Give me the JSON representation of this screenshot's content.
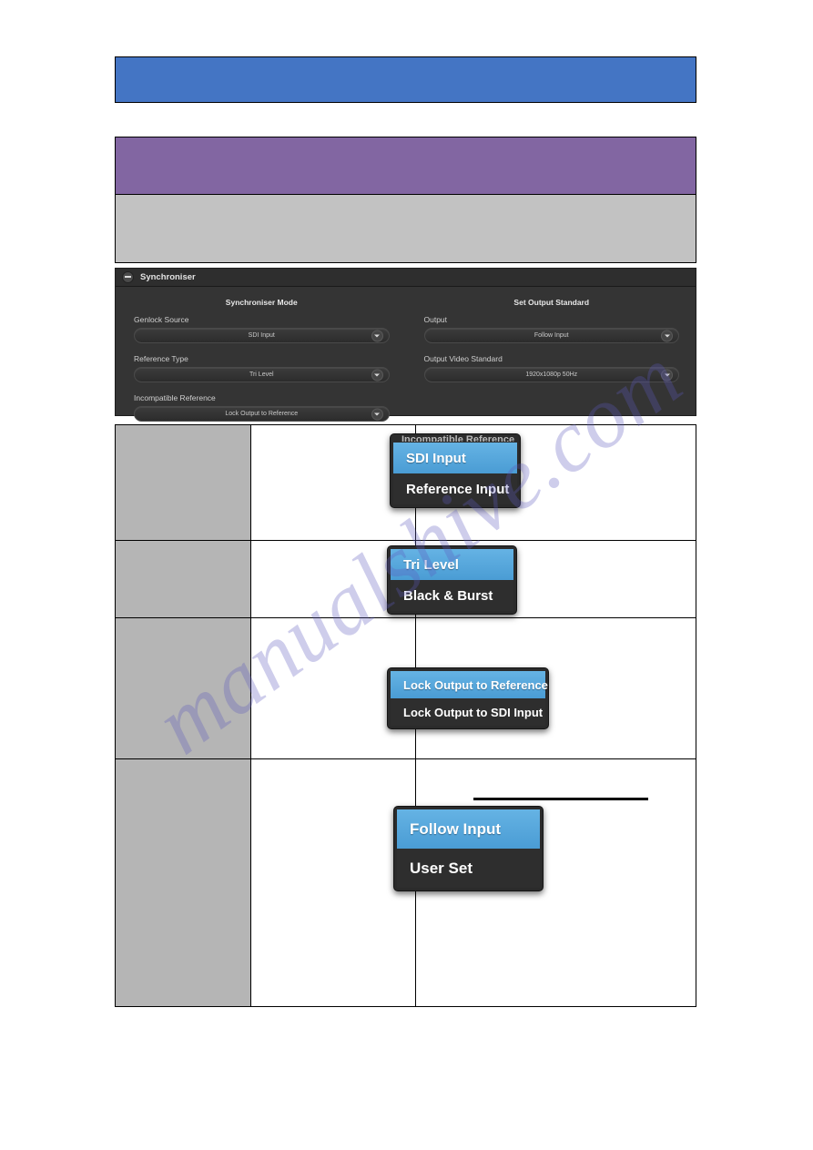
{
  "banners": {
    "blue": {
      "name": "blue-heading-bar",
      "color": "#4475c4",
      "text": ""
    },
    "purple": {
      "name": "purple-heading-bar",
      "color": "#8266a2",
      "text": ""
    },
    "gray": {
      "name": "gray-note-bar",
      "color": "#c2c2c2",
      "text": ""
    }
  },
  "sync_panel": {
    "title": "Synchroniser",
    "collapse_icon": "minus-circle-icon",
    "left": {
      "group_title": "Synchroniser Mode",
      "fields": [
        {
          "label": "Genlock Source",
          "value": "SDI Input"
        },
        {
          "label": "Reference Type",
          "value": "Tri Level"
        },
        {
          "label": "Incompatible Reference",
          "value": "Lock Output to Reference"
        }
      ]
    },
    "right": {
      "group_title": "Set Output Standard",
      "fields": [
        {
          "label": "Output",
          "value": "Follow Input"
        },
        {
          "label": "Output Video Standard",
          "value": "1920x1080p 50Hz"
        }
      ]
    }
  },
  "table": {
    "rows": [
      {
        "gray_cell": "",
        "mid_cell": "",
        "right_cell": "",
        "popup": {
          "name": "genlock-source-menu",
          "clipped_label": "Incompatible Reference",
          "items": [
            {
              "label": "SDI Input",
              "selected": true
            },
            {
              "label": "Reference Input",
              "selected": false
            }
          ]
        }
      },
      {
        "gray_cell": "",
        "mid_cell": "",
        "right_cell": "",
        "popup": {
          "name": "reference-type-menu",
          "clipped_label": "",
          "items": [
            {
              "label": "Tri Level",
              "selected": true
            },
            {
              "label": "Black & Burst",
              "selected": false
            }
          ]
        }
      },
      {
        "gray_cell": "",
        "mid_cell": "",
        "right_cell": "",
        "popup": {
          "name": "incompatible-reference-menu",
          "clipped_label": "",
          "items": [
            {
              "label": "Lock Output to Reference",
              "selected": true
            },
            {
              "label": "Lock Output to SDI Input",
              "selected": false
            }
          ]
        }
      },
      {
        "gray_cell": "",
        "mid_cell": "",
        "right_cell": "",
        "popup": {
          "name": "output-mode-menu",
          "clipped_label": "",
          "items": [
            {
              "label": "Follow Input",
              "selected": true
            },
            {
              "label": "User Set",
              "selected": false
            }
          ]
        }
      }
    ]
  },
  "watermark": {
    "line1": "manualshive.com"
  },
  "colors": {
    "accent_blue": "#4a9cd4",
    "banner_blue": "#4475c4",
    "banner_purple": "#8266a2",
    "banner_gray": "#c2c2c2",
    "panel_dark": "#343434",
    "table_gray": "#b5b5b5"
  }
}
